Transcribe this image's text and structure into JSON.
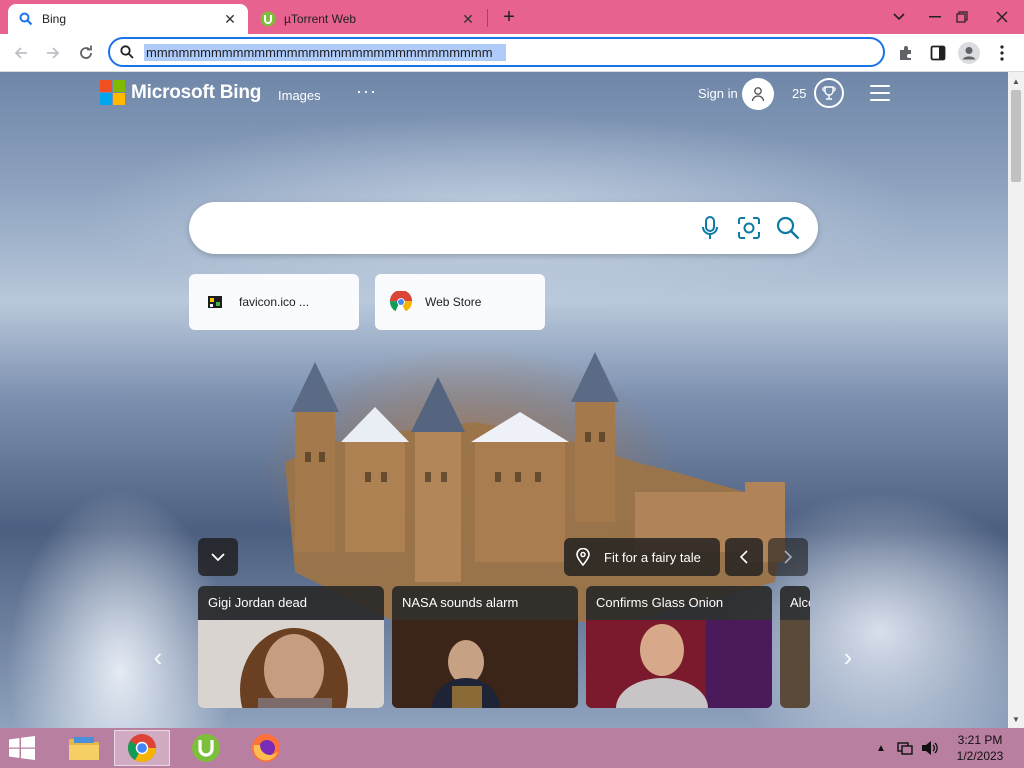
{
  "browser": {
    "tabs": [
      {
        "title": "Bing",
        "icon": "bing-search-icon",
        "active": true
      },
      {
        "title": "µTorrent Web",
        "icon": "utorrent-icon",
        "active": false
      }
    ],
    "address_bar": {
      "value": "mmmmmmmmmmmmmmmmmmmmmmmmmmmmmmmm"
    },
    "accent": "#1a73e8",
    "tabstrip_color": "#e8628f"
  },
  "bing": {
    "brand": "Microsoft Bing",
    "nav_images": "Images",
    "nav_more": "···",
    "sign_in": "Sign in",
    "points": "25",
    "search_placeholder": "",
    "quick_links": [
      {
        "label": "favicon.ico ...",
        "icon": "favicon-icon"
      },
      {
        "label": "Web Store",
        "icon": "chrome-web-store-icon"
      }
    ],
    "image_caption": "Fit for a fairy tale",
    "news": [
      {
        "headline": "Gigi Jordan dead"
      },
      {
        "headline": "NASA sounds alarm"
      },
      {
        "headline": "Confirms Glass Onion"
      },
      {
        "headline": "Alco"
      }
    ]
  },
  "taskbar": {
    "apps": [
      {
        "name": "file-explorer-icon"
      },
      {
        "name": "chrome-icon",
        "active": true
      },
      {
        "name": "utorrent-icon"
      },
      {
        "name": "firefox-icon"
      }
    ],
    "clock_time": "3:21 PM",
    "clock_date": "1/2/2023",
    "color": "#b87fa0"
  }
}
